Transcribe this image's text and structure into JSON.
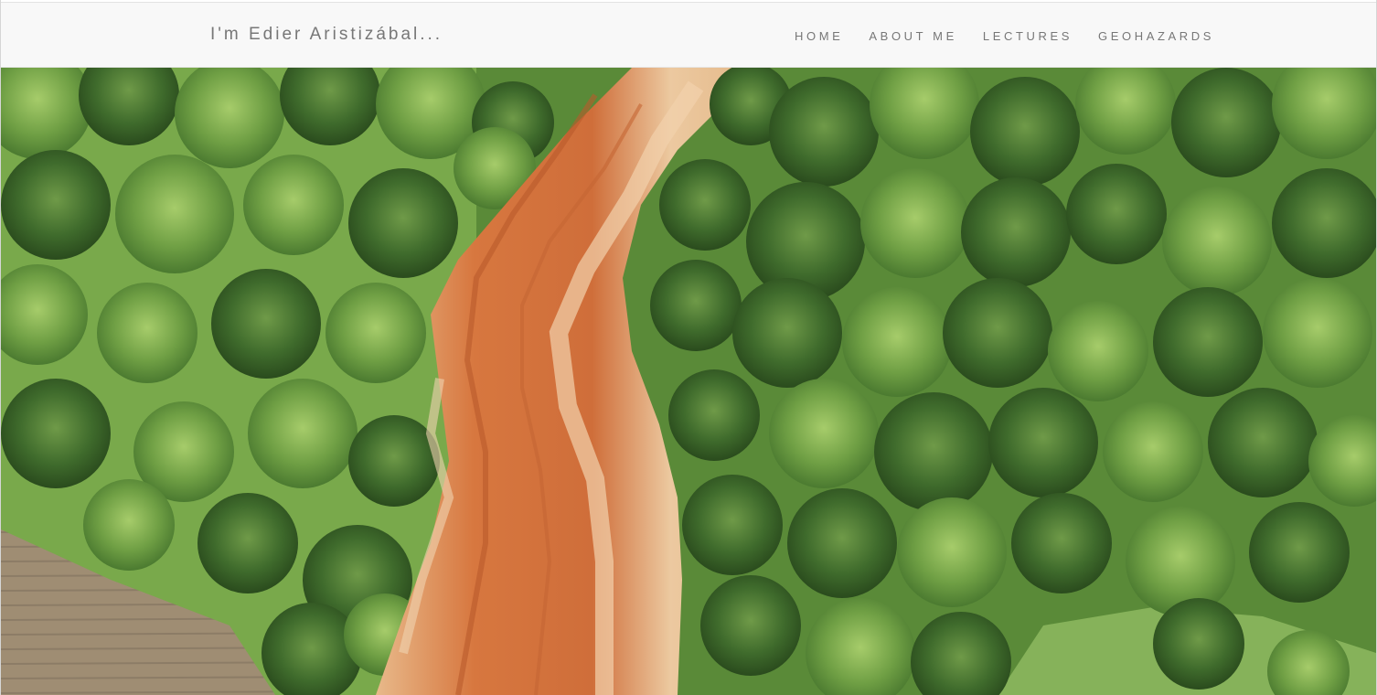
{
  "navbar": {
    "brand": "I'm Edier Aristizábal...",
    "links": [
      "HOME",
      "ABOUT ME",
      "LECTURES",
      "GEOHAZARDS"
    ]
  },
  "hero": {
    "image": "aerial-landslide-photo",
    "colors": {
      "forest_dark": "#3f6b2c",
      "forest_light": "#7fae4d",
      "landslide_orange": "#d9804a",
      "landslide_pale": "#ecc59a",
      "field_brown": "#9a8a72"
    }
  }
}
